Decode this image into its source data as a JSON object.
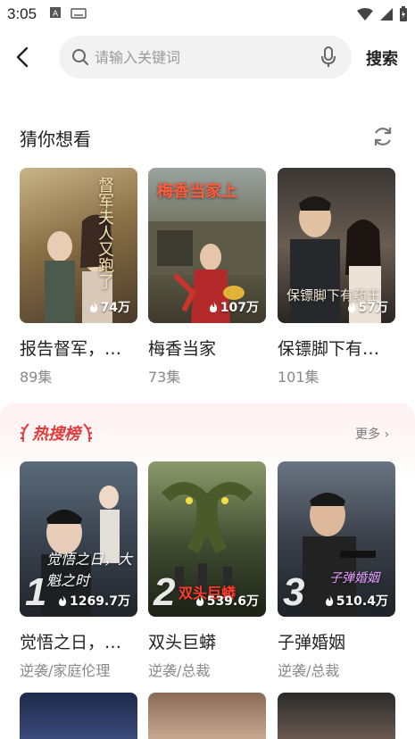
{
  "status_bar": {
    "time": "3:05"
  },
  "header": {
    "search_placeholder": "请输入关键词",
    "search_button": "搜索"
  },
  "guess": {
    "title": "猜你想看",
    "items": [
      {
        "title": "报告督军，夫人又跑了",
        "title_display": "报告督军，…",
        "sub": "89集",
        "heat": "74万",
        "poster_text": "督军夫人又跑了"
      },
      {
        "title": "梅香当家",
        "title_display": "梅香当家",
        "sub": "73集",
        "heat": "107万",
        "poster_text": "梅香当家上"
      },
      {
        "title": "保镖脚下有…",
        "title_display": "保镖脚下有…",
        "sub": "101集",
        "heat": "57万",
        "poster_text": "保镖脚下有药王"
      }
    ]
  },
  "hot": {
    "title": "热搜榜",
    "more": "更多",
    "items": [
      {
        "title": "觉悟之日，…",
        "sub": "逆袭/家庭伦理",
        "heat": "1269.7万",
        "rank": "1",
        "poster_text": "觉悟之日，大魁之时"
      },
      {
        "title": "双头巨蟒",
        "sub": "逆袭/总裁",
        "heat": "539.6万",
        "rank": "2",
        "poster_text": "双头巨蟒"
      },
      {
        "title": "子弹婚姻",
        "sub": "逆袭/总裁",
        "heat": "510.4万",
        "rank": "3",
        "poster_text": "子弹婚姻"
      }
    ]
  },
  "colors": {
    "accent_red": "#e53a3a"
  }
}
